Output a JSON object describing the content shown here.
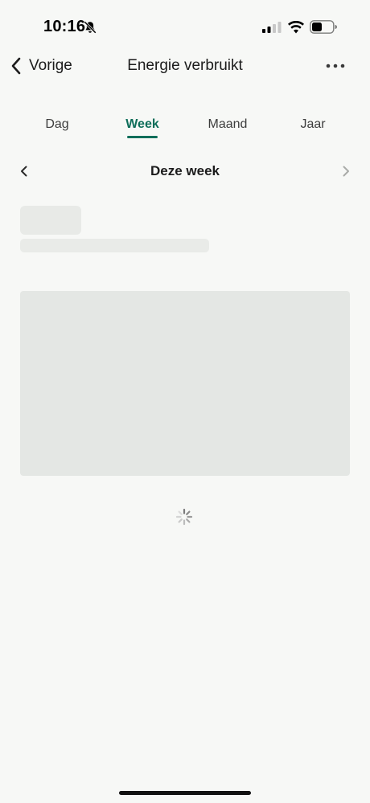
{
  "status_bar": {
    "time": "10:16",
    "icons": [
      "bell-slash-icon",
      "signal-icon",
      "wifi-icon",
      "battery-icon"
    ]
  },
  "header": {
    "back_label": "Vorige",
    "title": "Energie verbruikt",
    "more_icon": "more-horizontal-icon"
  },
  "tabs": [
    {
      "label": "Dag",
      "active": false
    },
    {
      "label": "Week",
      "active": true
    },
    {
      "label": "Maand",
      "active": false
    },
    {
      "label": "Jaar",
      "active": false
    }
  ],
  "period": {
    "label": "Deze week",
    "prev_icon": "chevron-left-icon",
    "next_icon": "chevron-right-icon"
  },
  "colors": {
    "accent": "#0e6e5a",
    "background": "#f7f8f6",
    "skeleton": "#e4e7e4"
  },
  "loading": {
    "spinner_icon": "spinner-icon"
  }
}
